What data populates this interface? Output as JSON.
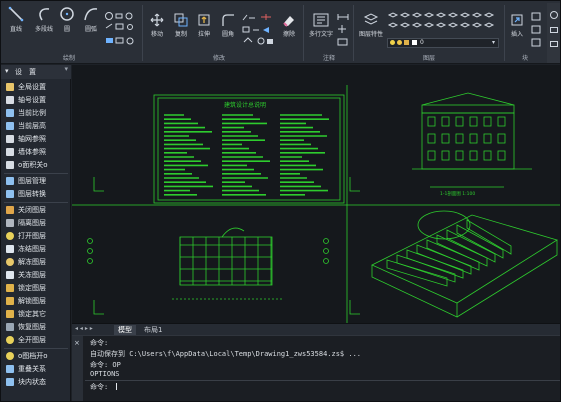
{
  "ribbon": {
    "draw": {
      "group_label": "绘制",
      "line": "直线",
      "polyline": "多段线",
      "circle": "圆",
      "arc": "圆弧"
    },
    "modify": {
      "group_label": "修改",
      "move": "移动",
      "copy": "复制",
      "stretch": "拉伸",
      "fillet": "圆角",
      "erase": "擦除"
    },
    "annotate": {
      "group_label": "注释",
      "mtext": "多行文字"
    },
    "layers": {
      "group_label": "图层",
      "layer_props": "图层特性",
      "current_layer": "0"
    },
    "block": {
      "group_label": "块",
      "insert": "插入"
    }
  },
  "left_panel": {
    "header": "设　置",
    "items": [
      {
        "label": "全局设置",
        "icon": "settings-icon",
        "color": "#e8c56a"
      },
      {
        "label": "轴号设置",
        "icon": "axis-icon",
        "color": "#d7dce3"
      },
      {
        "label": "当前比例",
        "icon": "scale-icon",
        "color": "#8ec0ef"
      },
      {
        "label": "当前层高",
        "icon": "height-icon",
        "color": "#8ec0ef"
      },
      {
        "label": "轴网参照",
        "icon": "grid-icon",
        "color": "#d7dce3"
      },
      {
        "label": "墙体参照",
        "icon": "wall-icon",
        "color": "#d7dce3"
      },
      {
        "label": "o面积关o",
        "icon": "area-icon",
        "color": "#d7dce3"
      },
      {
        "label": "图层管理",
        "icon": "layers-icon",
        "color": "#8ec0ef"
      },
      {
        "label": "图层转换",
        "icon": "layer-convert-icon",
        "color": "#8ec0ef"
      },
      {
        "label": "关闭图层",
        "icon": "layer-off-icon",
        "color": "#e0a64a"
      },
      {
        "label": "隔离图层",
        "icon": "layer-isolate-icon",
        "color": "#b0b6bf"
      },
      {
        "label": "打开图层",
        "icon": "bulb-icon",
        "color": "#e8d15a"
      },
      {
        "label": "冻结图层",
        "icon": "snowflake-icon",
        "color": "#dfe6ee"
      },
      {
        "label": "解冻图层",
        "icon": "sun-icon",
        "color": "#e8c86a"
      },
      {
        "label": "关冻图层",
        "icon": "snowflake-icon",
        "color": "#dfe6ee"
      },
      {
        "label": "锁定图层",
        "icon": "lock-icon",
        "color": "#e0b24a"
      },
      {
        "label": "解锁图层",
        "icon": "unlock-icon",
        "color": "#e0b24a"
      },
      {
        "label": "锁定其它",
        "icon": "lock-icon",
        "color": "#e0b24a"
      },
      {
        "label": "恢复图层",
        "icon": "restore-icon",
        "color": "#9aa7b5"
      },
      {
        "label": "全开图层",
        "icon": "bulb-icon",
        "color": "#e8d15a"
      },
      {
        "label": "o图档开o",
        "icon": "bulb-icon",
        "color": "#e8d15a"
      },
      {
        "label": "重叠关系",
        "icon": "overlap-icon",
        "color": "#8ec0ef"
      },
      {
        "label": "块内状态",
        "icon": "block-icon",
        "color": "#8ec0ef"
      }
    ]
  },
  "drawing": {
    "sheet_title": "建筑设计总说明",
    "section_label": "1-1剖面图 1:100"
  },
  "tabs": [
    {
      "label": "模型",
      "active": true
    },
    {
      "label": "布局1",
      "active": false
    }
  ],
  "command": {
    "lines": [
      "命令:",
      "自动保存到 C:\\Users\\f\\AppData\\Local\\Temp\\Drawing1_zws53584.zs$ ...",
      "命令: OP",
      "OPTIONS"
    ],
    "prompt": "命令:"
  },
  "colors": {
    "cad_green": "#2ecc2e",
    "sheet_bg": "#15181c"
  }
}
